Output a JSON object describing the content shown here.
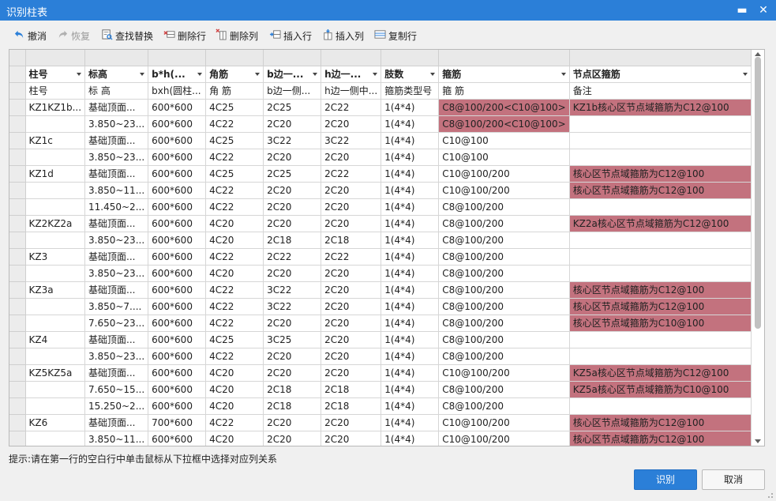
{
  "window": {
    "title": "识别柱表",
    "minimize_glyph": "▬",
    "close_glyph": "✕"
  },
  "toolbar": [
    {
      "label": "撤消",
      "icon": "undo-icon",
      "enabled": true
    },
    {
      "label": "恢复",
      "icon": "redo-icon",
      "enabled": false
    },
    {
      "label": "查找替换",
      "icon": "find-replace-icon",
      "enabled": true
    },
    {
      "label": "删除行",
      "icon": "delete-row-icon",
      "enabled": true
    },
    {
      "label": "删除列",
      "icon": "delete-column-icon",
      "enabled": true
    },
    {
      "label": "插入行",
      "icon": "insert-row-icon",
      "enabled": true
    },
    {
      "label": "插入列",
      "icon": "insert-column-icon",
      "enabled": true
    },
    {
      "label": "复制行",
      "icon": "copy-row-icon",
      "enabled": true
    }
  ],
  "columns": [
    "柱号",
    "标高",
    "b*h(...",
    "角筋",
    "b边一...",
    "h边一...",
    "肢数",
    "箍筋",
    "节点区箍筋"
  ],
  "header_row": [
    "柱号",
    "标 高",
    "bxh(圆柱...",
    "角 筋",
    "b边一侧...",
    "h边一侧中...",
    "箍筋类型号",
    "箍 筋",
    "备注"
  ],
  "rows": [
    {
      "cells": [
        "KZ1KZ1b...",
        "基础顶面...",
        "600*600",
        "4C25",
        "2C25",
        "2C22",
        "1(4*4)",
        "C8@100/200<C10@100>",
        "KZ1b核心区节点域箍筋为C12@100"
      ],
      "hl": [
        7,
        8
      ]
    },
    {
      "cells": [
        "",
        "3.850~23...",
        "600*600",
        "4C22",
        "2C20",
        "2C20",
        "1(4*4)",
        "C8@100/200<C10@100>",
        ""
      ],
      "hl": [
        7
      ]
    },
    {
      "cells": [
        "KZ1c",
        "基础顶面...",
        "600*600",
        "4C25",
        "3C22",
        "3C22",
        "1(4*4)",
        "C10@100",
        ""
      ],
      "hl": []
    },
    {
      "cells": [
        "",
        "3.850~23...",
        "600*600",
        "4C22",
        "2C20",
        "2C20",
        "1(4*4)",
        "C10@100",
        ""
      ],
      "hl": []
    },
    {
      "cells": [
        "KZ1d",
        "基础顶面...",
        "600*600",
        "4C25",
        "2C25",
        "2C22",
        "1(4*4)",
        "C10@100/200",
        "核心区节点域箍筋为C12@100"
      ],
      "hl": [
        8
      ]
    },
    {
      "cells": [
        "",
        "3.850~11...",
        "600*600",
        "4C22",
        "2C20",
        "2C20",
        "1(4*4)",
        "C10@100/200",
        "核心区节点域箍筋为C12@100"
      ],
      "hl": [
        8
      ]
    },
    {
      "cells": [
        "",
        "11.450~2...",
        "600*600",
        "4C22",
        "2C20",
        "2C20",
        "1(4*4)",
        "C8@100/200",
        ""
      ],
      "hl": []
    },
    {
      "cells": [
        "KZ2KZ2a",
        "基础顶面...",
        "600*600",
        "4C20",
        "2C20",
        "2C20",
        "1(4*4)",
        "C8@100/200",
        "KZ2a核心区节点域箍筋为C12@100"
      ],
      "hl": [
        8
      ]
    },
    {
      "cells": [
        "",
        "3.850~23...",
        "600*600",
        "4C20",
        "2C18",
        "2C18",
        "1(4*4)",
        "C8@100/200",
        ""
      ],
      "hl": []
    },
    {
      "cells": [
        "KZ3",
        "基础顶面...",
        "600*600",
        "4C22",
        "2C22",
        "2C22",
        "1(4*4)",
        "C8@100/200",
        ""
      ],
      "hl": []
    },
    {
      "cells": [
        "",
        "3.850~23...",
        "600*600",
        "4C20",
        "2C20",
        "2C20",
        "1(4*4)",
        "C8@100/200",
        ""
      ],
      "hl": []
    },
    {
      "cells": [
        "KZ3a",
        "基础顶面...",
        "600*600",
        "4C22",
        "3C22",
        "2C20",
        "1(4*4)",
        "C8@100/200",
        "核心区节点域箍筋为C12@100"
      ],
      "hl": [
        8
      ]
    },
    {
      "cells": [
        "",
        "3.850~7....",
        "600*600",
        "4C22",
        "3C22",
        "2C20",
        "1(4*4)",
        "C8@100/200",
        "核心区节点域箍筋为C12@100"
      ],
      "hl": [
        8
      ]
    },
    {
      "cells": [
        "",
        "7.650~23...",
        "600*600",
        "4C22",
        "2C20",
        "2C20",
        "1(4*4)",
        "C8@100/200",
        "核心区节点域箍筋为C10@100"
      ],
      "hl": [
        8
      ]
    },
    {
      "cells": [
        "KZ4",
        "基础顶面...",
        "600*600",
        "4C25",
        "3C25",
        "2C20",
        "1(4*4)",
        "C8@100/200",
        ""
      ],
      "hl": []
    },
    {
      "cells": [
        "",
        "3.850~23...",
        "600*600",
        "4C22",
        "2C20",
        "2C20",
        "1(4*4)",
        "C8@100/200",
        ""
      ],
      "hl": []
    },
    {
      "cells": [
        "KZ5KZ5a",
        "基础顶面...",
        "600*600",
        "4C20",
        "2C20",
        "2C20",
        "1(4*4)",
        "C10@100/200",
        "KZ5a核心区节点域箍筋为C12@100"
      ],
      "hl": [
        8
      ]
    },
    {
      "cells": [
        "",
        "7.650~15...",
        "600*600",
        "4C20",
        "2C18",
        "2C18",
        "1(4*4)",
        "C8@100/200",
        "KZ5a核心区节点域箍筋为C10@100"
      ],
      "hl": [
        8
      ]
    },
    {
      "cells": [
        "",
        "15.250~2...",
        "600*600",
        "4C20",
        "2C18",
        "2C18",
        "1(4*4)",
        "C8@100/200",
        ""
      ],
      "hl": []
    },
    {
      "cells": [
        "KZ6",
        "基础顶面...",
        "700*600",
        "4C22",
        "2C20",
        "2C20",
        "1(4*4)",
        "C10@100/200",
        "核心区节点域箍筋为C12@100"
      ],
      "hl": [
        8
      ]
    },
    {
      "cells": [
        "",
        "3.850~11...",
        "600*600",
        "4C20",
        "2C20",
        "2C20",
        "1(4*4)",
        "C10@100/200",
        "核心区节点域箍筋为C12@100"
      ],
      "hl": [
        8
      ]
    }
  ],
  "hint": "提示:请在第一行的空白行中单击鼠标从下拉框中选择对应列关系",
  "buttons": {
    "ok": "识别",
    "cancel": "取消"
  },
  "colors": {
    "accent": "#2b7fd8",
    "highlight": "#c3727e"
  }
}
